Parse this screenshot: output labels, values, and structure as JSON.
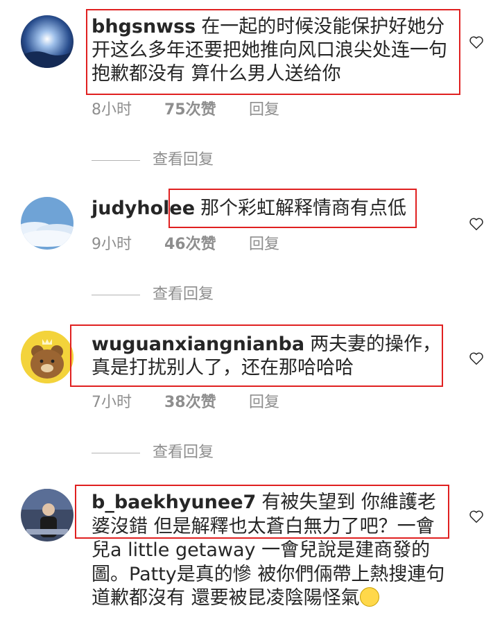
{
  "comments": [
    {
      "username": "bhgsnwss",
      "text": "在一起的时候没能保护好她分开这么多年还要把她推向风口浪尖处连一句抱歉都没有 算什么男人送给你",
      "time": "8小时",
      "likes": "75次赞",
      "reply": "回复",
      "view_replies": "查看回复"
    },
    {
      "username": "judyholee",
      "text": "那个彩虹解释情商有点低",
      "time": "9小时",
      "likes": "46次赞",
      "reply": "回复",
      "view_replies": "查看回复"
    },
    {
      "username": "wuguanxiangnianba",
      "text": "两夫妻的操作，真是打扰别人了，还在那哈哈哈",
      "time": "7小时",
      "likes": "38次赞",
      "reply": "回复",
      "view_replies": "查看回复"
    },
    {
      "username": "b_baekhyunee7",
      "text": "有被失望到 你維護老婆沒錯 但是解釋也太蒼白無力了吧？一會兒a little getaway 一會兒說是建商發的圖。Patty是真的慘 被你們倆帶上熱搜連句道歉都沒有 還要被昆凌陰陽怪氣",
      "emoji": "slightly-smiling-face-emoji"
    }
  ],
  "colors": {
    "text": "#262626",
    "meta": "#8e8e8e",
    "annotation_box": "#e02020"
  }
}
